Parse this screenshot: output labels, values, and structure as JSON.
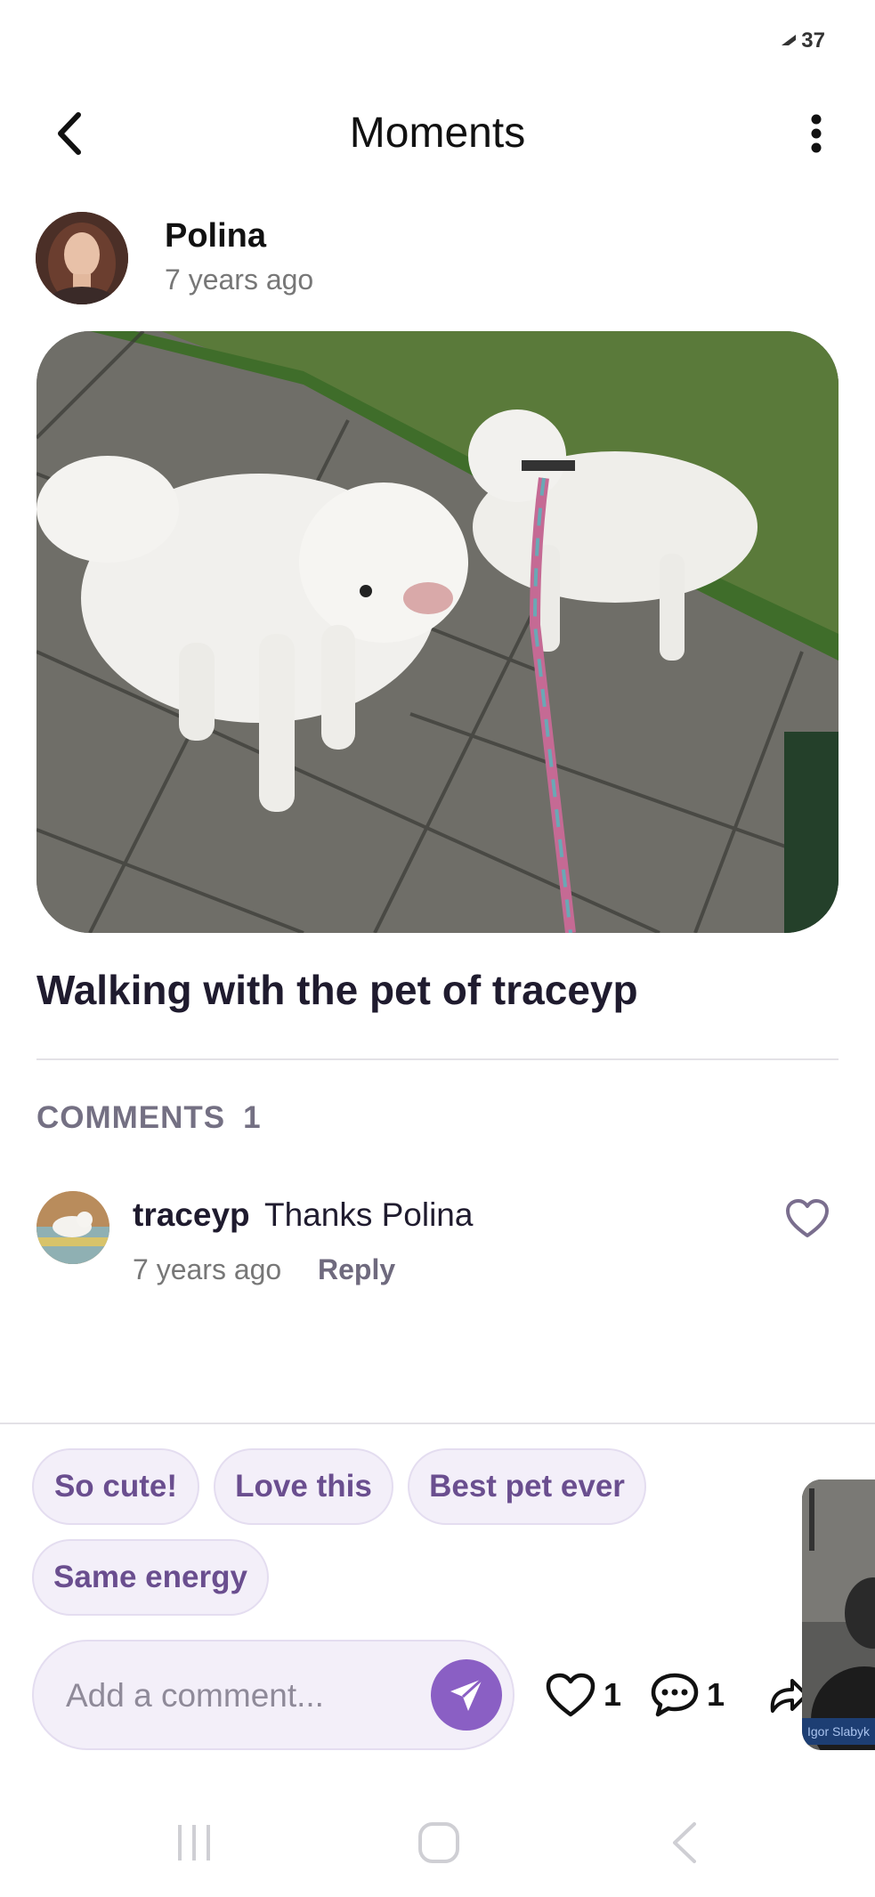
{
  "status_bar": {
    "signal_text": "37"
  },
  "app_bar": {
    "title": "Moments",
    "back_icon": "chevron-left-icon",
    "more_icon": "more-vertical-icon"
  },
  "post": {
    "author": "Polina",
    "time": "7 years ago",
    "caption": "Walking with the pet of traceyp"
  },
  "comments": {
    "label": "COMMENTS",
    "count": "1",
    "items": [
      {
        "user": "traceyp",
        "text": "Thanks Polina",
        "time": "7 years ago",
        "reply_label": "Reply"
      }
    ]
  },
  "quick_replies": [
    "So cute!",
    "Love this",
    "Best pet ever",
    "Same energy"
  ],
  "composer": {
    "placeholder": "Add a comment..."
  },
  "actions": {
    "likes": "1",
    "comments": "1"
  },
  "video_overlay": {
    "name": "Igor Slabyk"
  },
  "colors": {
    "accent": "#8a5fc4",
    "chip_bg": "#f3eff9",
    "chip_text": "#6a4e8f"
  }
}
